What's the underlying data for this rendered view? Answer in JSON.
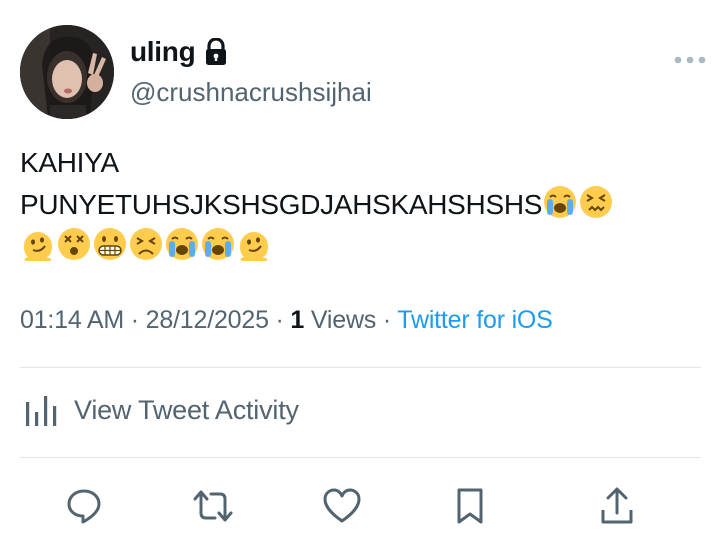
{
  "author": {
    "display_name": "uling",
    "handle": "@crushnacrushsijhai"
  },
  "tweet": {
    "line1": "KAHIYA",
    "line2": "PUNYETUHSJKSHSGDJAHSKAHSHSHS",
    "line2_emojis": [
      "loudly-crying-face-icon",
      "confounded-face-icon"
    ],
    "line3_emojis": [
      "melting-face-icon",
      "dizzy-face-icon",
      "grimacing-face-icon",
      "persevering-face-icon",
      "loudly-crying-face-icon",
      "loudly-crying-face-icon",
      "melting-face-icon"
    ]
  },
  "meta": {
    "time": "01:14 AM",
    "separator": " · ",
    "date": "28/12/2025",
    "views_count": "1",
    "views_label": " Views",
    "source": "Twitter for iOS"
  },
  "activity": {
    "label": "View Tweet Activity"
  },
  "colors": {
    "text": "#0f1419",
    "secondary": "#536471",
    "link": "#1d9bf0",
    "divider": "#e1e6ea"
  }
}
